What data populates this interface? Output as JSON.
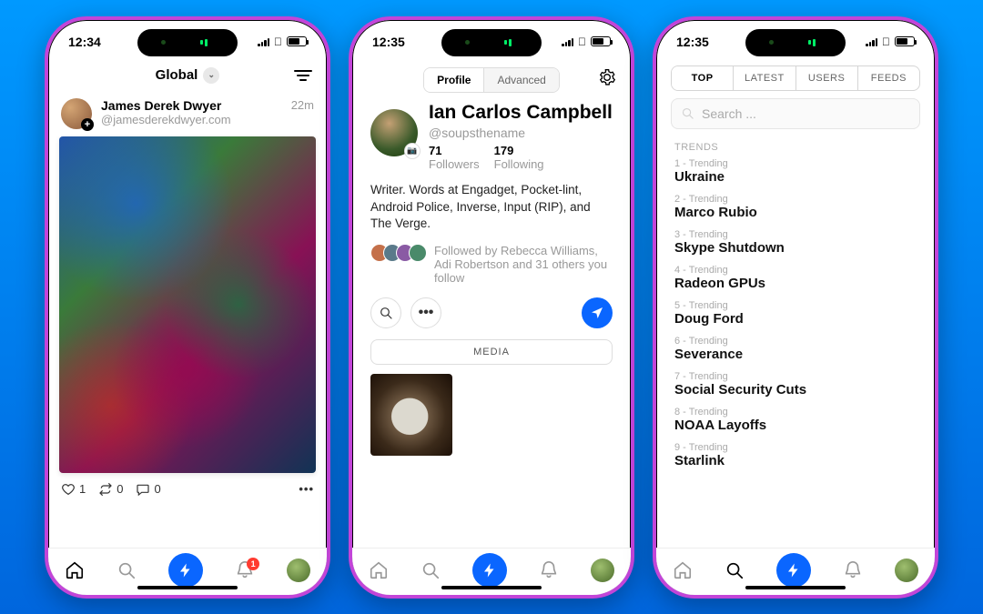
{
  "status": {
    "time1": "12:34",
    "time2": "12:35",
    "time3": "12:35"
  },
  "phone1": {
    "header_title": "Global",
    "post": {
      "author": "James Derek Dwyer",
      "handle": "@jamesderekdwyer.com",
      "time": "22m",
      "likes": "1",
      "reposts": "0",
      "comments": "0"
    },
    "badge": "1"
  },
  "phone2": {
    "tabs": {
      "profile": "Profile",
      "advanced": "Advanced"
    },
    "name": "Ian Carlos Campbell",
    "handle": "@soupsthename",
    "followers_n": "71",
    "followers_l": "Followers",
    "following_n": "179",
    "following_l": "Following",
    "bio": "Writer. Words at Engadget, Pocket-lint, Android Police, Inverse, Input (RIP), and The Verge.",
    "followed_by": "Followed by Rebecca Williams, Adi Robertson and 31 others you follow",
    "media_label": "MEDIA"
  },
  "phone3": {
    "tabs": {
      "top": "TOP",
      "latest": "LATEST",
      "users": "USERS",
      "feeds": "FEEDS"
    },
    "search_placeholder": "Search ...",
    "trends_label": "TRENDS",
    "trends": [
      {
        "rank": "1 - Trending",
        "name": "Ukraine"
      },
      {
        "rank": "2 - Trending",
        "name": "Marco Rubio"
      },
      {
        "rank": "3 - Trending",
        "name": "Skype Shutdown"
      },
      {
        "rank": "4 - Trending",
        "name": "Radeon GPUs"
      },
      {
        "rank": "5 - Trending",
        "name": "Doug Ford"
      },
      {
        "rank": "6 - Trending",
        "name": "Severance"
      },
      {
        "rank": "7 - Trending",
        "name": "Social Security Cuts"
      },
      {
        "rank": "8 - Trending",
        "name": "NOAA Layoffs"
      },
      {
        "rank": "9 - Trending",
        "name": "Starlink"
      }
    ]
  }
}
